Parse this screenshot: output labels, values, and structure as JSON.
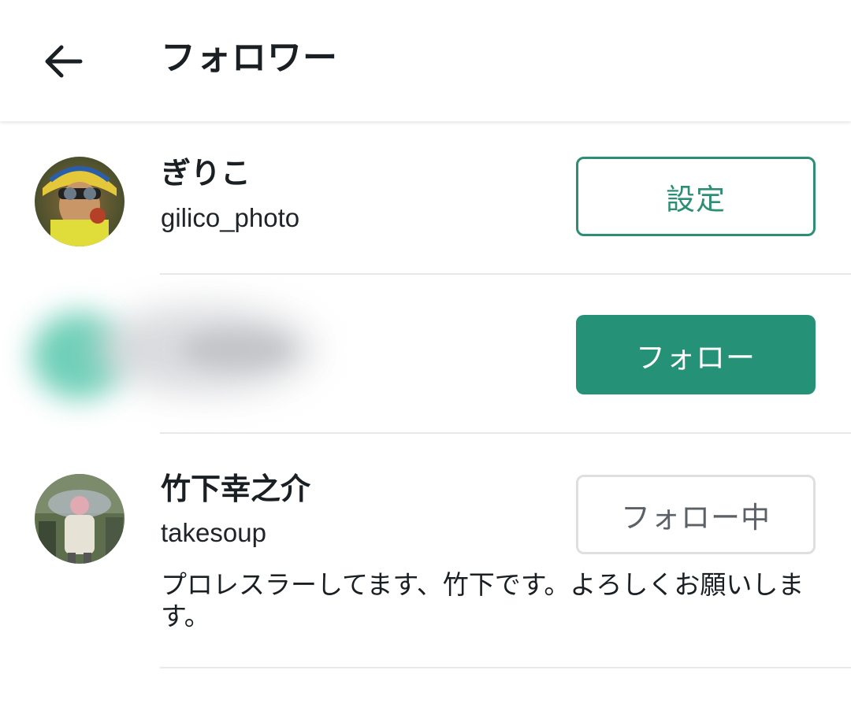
{
  "header": {
    "back_icon": "arrow-left-icon",
    "title": "フォロワー"
  },
  "users": [
    {
      "name": "ぎりこ",
      "handle": "gilico_photo",
      "button_label": "設定",
      "button_state": "settings"
    },
    {
      "name": "",
      "handle": "",
      "button_label": "フォロー",
      "button_state": "follow",
      "obscured": true
    },
    {
      "name": "竹下幸之介",
      "handle": "takesoup",
      "bio": "プロレスラーしてます、竹下です。よろしくお願いします。",
      "button_label": "フォロー中",
      "button_state": "following"
    }
  ],
  "colors": {
    "accent": "#259278",
    "accent_outline": "#2c8f73",
    "divider": "#e6e8ea",
    "following_border": "#dddfe1",
    "following_text": "#5b6166"
  }
}
